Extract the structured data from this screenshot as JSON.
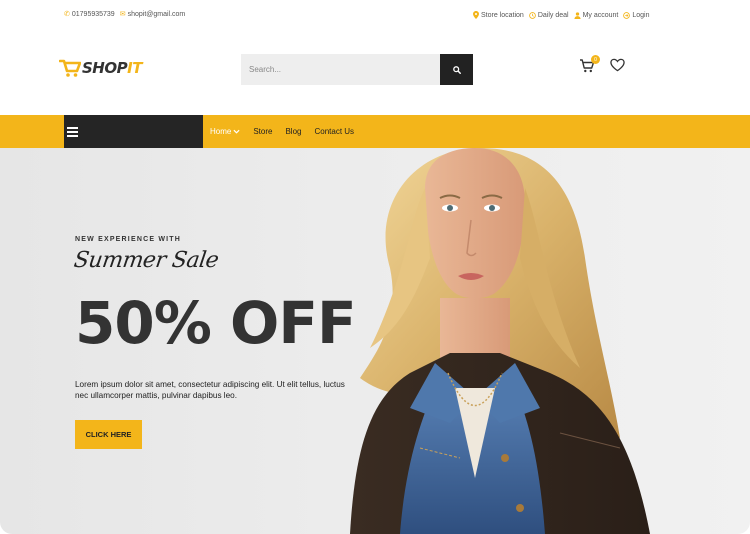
{
  "topbar": {
    "phone": "01795935739",
    "email": "shopit@gmail.com",
    "links": [
      {
        "label": "Store location",
        "icon": "map-pin-icon"
      },
      {
        "label": "Daily deal",
        "icon": "clock-icon"
      },
      {
        "label": "My account",
        "icon": "user-icon"
      },
      {
        "label": "Login",
        "icon": "login-icon"
      }
    ]
  },
  "header": {
    "logo": {
      "part1": "SHOP",
      "part2": "IT"
    },
    "search": {
      "placeholder": "Search..."
    },
    "cart_count": "0"
  },
  "nav": {
    "items": [
      {
        "label": "Home",
        "active": true
      },
      {
        "label": "Store"
      },
      {
        "label": "Blog"
      },
      {
        "label": "Contact Us"
      }
    ]
  },
  "hero": {
    "kicker": "NEW EXPERIENCE WITH",
    "script": "Summer Sale",
    "headline": "50% OFF",
    "description": "Lorem ipsum dolor sit amet, consectetur adipiscing elit. Ut elit tellus, luctus nec ullamcorper mattis, pulvinar dapibus leo.",
    "cta": "CLICK HERE"
  },
  "colors": {
    "accent": "#f3b51a",
    "dark": "#252525",
    "text": "#333333"
  }
}
